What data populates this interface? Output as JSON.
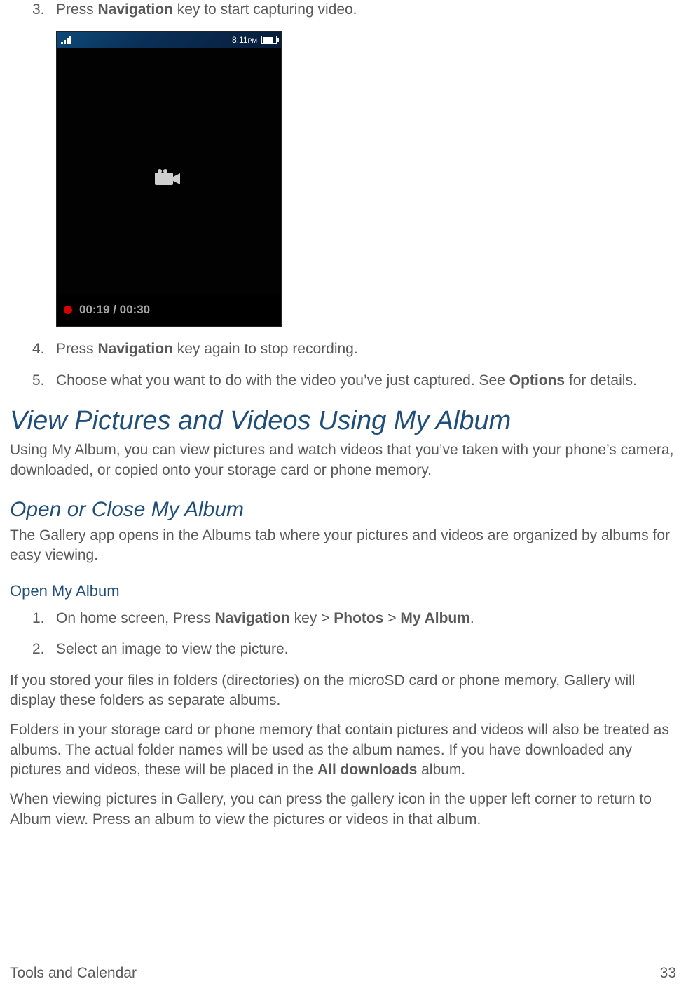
{
  "top_list": [
    {
      "n": "3.",
      "pre": "Press ",
      "bold": "Navigation",
      "post": " key to start capturing video."
    }
  ],
  "phone": {
    "time": "8:11",
    "ampm": "PM",
    "rec_time": "00:19 / 00:30"
  },
  "mid_list": [
    {
      "n": "4.",
      "pre": "Press ",
      "bold": "Navigation",
      "post": " key again to stop recording."
    },
    {
      "n": "5.",
      "pre": "Choose what you want to do with the video you’ve just captured. See ",
      "bold": "Options",
      "post": " for details."
    }
  ],
  "h1": "View Pictures and Videos Using My Album",
  "p1": "Using My Album, you can view pictures and watch videos that you’ve taken with your phone’s camera, downloaded, or copied onto your storage card or phone memory.",
  "h2": "Open or Close My Album",
  "p2": "The Gallery app opens in the Albums tab where your pictures and videos are organized by albums for easy viewing.",
  "h3": "Open My Album",
  "steps": {
    "s1": {
      "n": "1.",
      "pre": "On home screen, Press ",
      "b1": "Navigation",
      "mid1": " key > ",
      "b2": "Photos",
      "mid2": " > ",
      "b3": "My Album",
      "post": "."
    },
    "s2": {
      "n": "2.",
      "text": "Select an image to view the picture."
    }
  },
  "p3": "If you stored your files in folders (directories) on the microSD card or phone memory, Gallery will display these folders as separate albums.",
  "p4_a": "Folders in your storage card or phone memory that contain pictures and videos will also be treated as albums. The actual folder names will be used as the album names. If you have downloaded any pictures and videos, these will be placed in the ",
  "p4_b": "All downloads",
  "p4_c": " album.",
  "p5": "When viewing pictures in Gallery, you can press the gallery icon in the upper left corner to return to Album view. Press an album to view the pictures or videos in that album.",
  "footer_left": "Tools and Calendar",
  "footer_right": "33"
}
